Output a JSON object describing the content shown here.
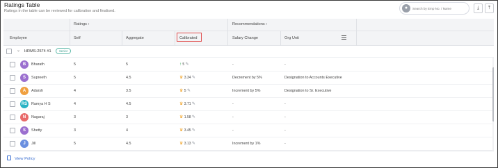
{
  "header": {
    "title": "Ratings Table",
    "subtitle": "Ratings in the table can be reviewed for calibration and finalised.",
    "search_placeholder": "Search by Emp No. / Name",
    "search_avatar_icon": "user-icon",
    "download_icon": "download-icon",
    "upload_icon": "upload-icon"
  },
  "table": {
    "group_headers": {
      "ratings": "Ratings  ›",
      "recommendations": "Recommendations  ›"
    },
    "columns": {
      "employee": "Employee",
      "self": "Self",
      "aggregate": "Aggregate",
      "calibrated": "Calibrated",
      "salary_change": "Salary Change",
      "org_unit": "Org Unit"
    },
    "group": {
      "label": "HRMS-2574 #1",
      "badge": "Senior"
    },
    "rows": [
      {
        "initial": "B",
        "name": "Bharath",
        "self": "5",
        "aggregate": "5",
        "calibrated": "5",
        "trend": "up",
        "salary_change": "-",
        "org_unit": "-",
        "avatar_color": "#9b6fcf"
      },
      {
        "initial": "S",
        "name": "Supreeth",
        "self": "5",
        "aggregate": "4.5",
        "calibrated": "3.34",
        "trend": "flag",
        "salary_change": "Decrement by 5%",
        "org_unit": "Designation to Accounts Executive",
        "avatar_color": "#9b6fcf"
      },
      {
        "initial": "A",
        "name": "Adarsh",
        "self": "4",
        "aggregate": "3.5",
        "calibrated": "5",
        "trend": "flag",
        "salary_change": "Increment by 5%",
        "org_unit": "Designation to Sr. Executive",
        "avatar_color": "#f0a040"
      },
      {
        "initial": "RS",
        "name": "Ramya H S",
        "self": "4",
        "aggregate": "4.5",
        "calibrated": "3.71",
        "trend": "flag",
        "salary_change": "-",
        "org_unit": "-",
        "avatar_color": "#2ab3c4"
      },
      {
        "initial": "N",
        "name": "Nagaraj",
        "self": "3",
        "aggregate": "3",
        "calibrated": "1.58",
        "trend": "flag",
        "salary_change": "-",
        "org_unit": "-",
        "avatar_color": "#e86a6a"
      },
      {
        "initial": "S",
        "name": "Shetty",
        "self": "3",
        "aggregate": "4",
        "calibrated": "3.45",
        "trend": "flag",
        "salary_change": "-",
        "org_unit": "-",
        "avatar_color": "#9b6fcf"
      },
      {
        "initial": "J",
        "name": "Jill",
        "self": "5",
        "aggregate": "4.5",
        "calibrated": "3.13",
        "trend": "flag",
        "salary_change": "Increment by 1%",
        "org_unit": "-",
        "avatar_color": "#6a8fe0"
      }
    ]
  },
  "footer": {
    "policy_link": "View Policy",
    "policy_icon": "document-icon"
  }
}
